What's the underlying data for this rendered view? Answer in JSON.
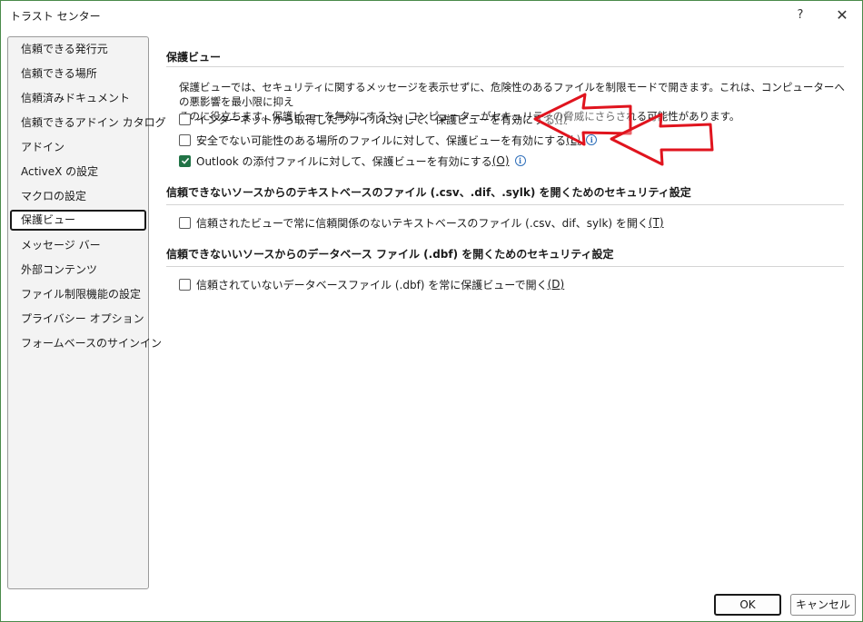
{
  "window": {
    "title": "トラスト センター",
    "help": "?",
    "close": "✕"
  },
  "sidebar": {
    "items": [
      {
        "label": "信頼できる発行元"
      },
      {
        "label": "信頼できる場所"
      },
      {
        "label": "信頼済みドキュメント"
      },
      {
        "label": "信頼できるアドイン カタログ"
      },
      {
        "label": "アドイン"
      },
      {
        "label": "ActiveX の設定"
      },
      {
        "label": "マクロの設定"
      },
      {
        "label": "保護ビュー",
        "selected": true
      },
      {
        "label": "メッセージ バー"
      },
      {
        "label": "外部コンテンツ"
      },
      {
        "label": "ファイル制限機能の設定"
      },
      {
        "label": "プライバシー オプション"
      },
      {
        "label": "フォームベースのサインイン"
      }
    ]
  },
  "main": {
    "protected_view": {
      "title": "保護ビュー",
      "description_line1": "保護ビューでは、セキュリティに関するメッセージを表示せずに、危険性のあるファイルを制限モードで開きます。これは、コンピューターへの悪影響を最小限に抑え",
      "description_line2": "るのに役立ちます。保護ビューを無効にすると、コンピューターがセキュリティの脅威にさらされる可能性があります。",
      "options": [
        {
          "label": "インターネットから取得したファイルに対して、保護ビューを有効にする",
          "accel": "(I)",
          "checked": false
        },
        {
          "label": "安全でない可能性のある場所のファイルに対して、保護ビューを有効にする",
          "accel": "(L)",
          "checked": false
        },
        {
          "label": "Outlook の添付ファイルに対して、保護ビューを有効にする",
          "accel": "(O)",
          "checked": true
        }
      ]
    },
    "text_files": {
      "title": "信頼できないソースからのテキストベースのファイル (.csv、.dif、.sylk) を開くためのセキュリティ設定",
      "option": {
        "label": "信頼されたビューで常に信頼関係のないテキストベースのファイル (.csv、dif、sylk) を開く",
        "accel": "(T)",
        "checked": false
      }
    },
    "dbf_files": {
      "title": "信頼できないいソースからのデータベース ファイル (.dbf) を開くためのセキュリティ設定",
      "option": {
        "label": "信頼されていないデータベースファイル (.dbf) を常に保護ビューで開く",
        "accel": "(D)",
        "checked": false
      }
    }
  },
  "footer": {
    "ok": "OK",
    "cancel": "キャンセル"
  },
  "colors": {
    "accent_green": "#217346",
    "annotation_red": "#e0141e",
    "info_blue": "#2f6fba"
  },
  "icons": {
    "info": "info-icon",
    "check": "checkmark-icon",
    "close": "close-icon",
    "help": "help-icon"
  }
}
